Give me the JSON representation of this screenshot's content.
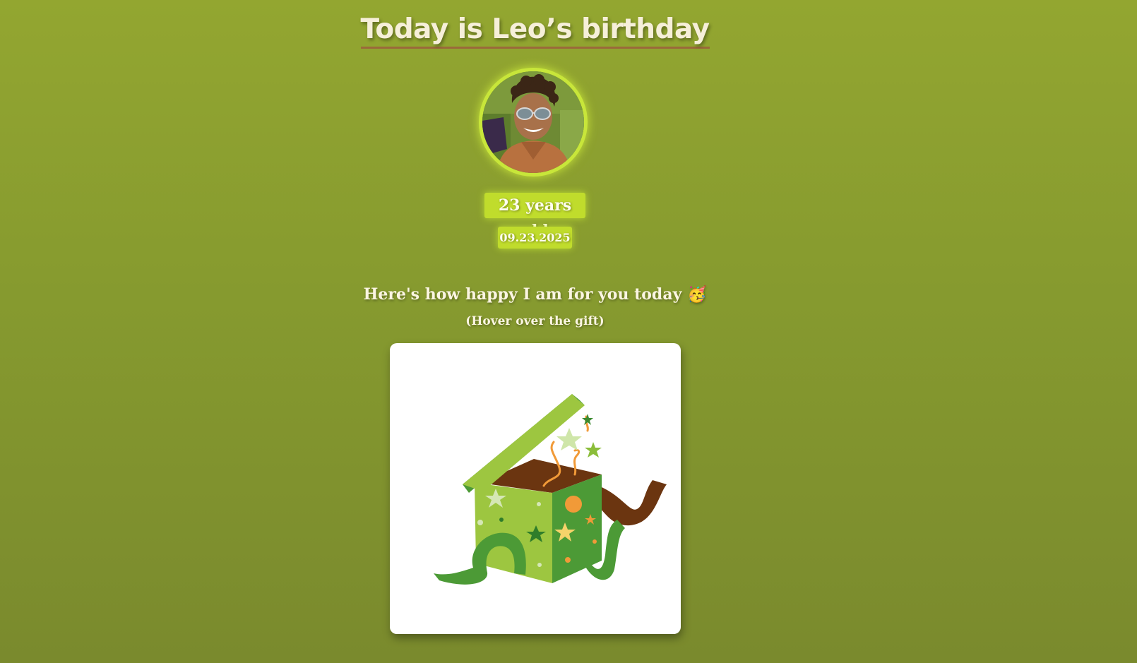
{
  "header": {
    "title": "Today is Leo’s birthday"
  },
  "profile": {
    "age_label": "23 years old",
    "date_label": "09.23.2025"
  },
  "message": {
    "text": "Here's how happy I am for you today 🥳",
    "hint": "(Hover over the gift)"
  },
  "gift": {
    "icon": "open-gift-box-icon"
  },
  "colors": {
    "background_top": "#93a630",
    "background_bottom": "#7a8a2d",
    "badge": "#c0dc2c",
    "avatar_ring": "#c8e63a",
    "box_light_green": "#9dc640",
    "box_dark_green": "#4c9a36",
    "box_inside": "#6b3510",
    "accent_orange": "#f19a38"
  }
}
